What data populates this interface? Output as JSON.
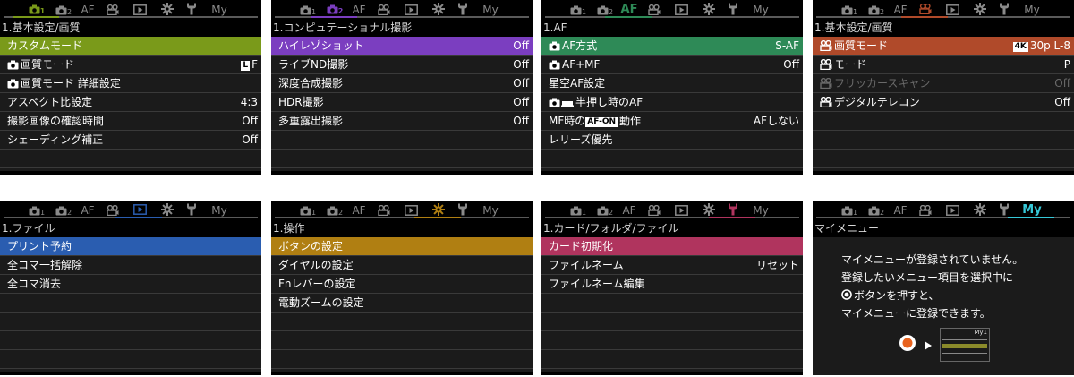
{
  "tab_icons": [
    "camera1-icon",
    "camera2-icon",
    "af-tab",
    "video-icon",
    "playback-icon",
    "gear-icon",
    "wrench-icon",
    "my-tab"
  ],
  "colors": {
    "shooting1": "#7a9a1a",
    "shooting2": "#7b3ec0",
    "af": "#2e8a57",
    "video": "#b04a2a",
    "playback": "#2a5db0",
    "custom": "#b07f12",
    "setup": "#b0345e",
    "my": "#36c9d9"
  },
  "tab_labels": {
    "af": "AF",
    "my": "My",
    "sub1": "1",
    "sub2": "2"
  },
  "panels": [
    {
      "id": "shooting1",
      "active": 0,
      "header": "1.基本設定/画質",
      "rows": [
        {
          "label": "カスタムモード",
          "value": ""
        },
        {
          "label": "画質モード",
          "value": "F",
          "icon": "camera",
          "value_badge": "L"
        },
        {
          "label": "画質モード 詳細設定",
          "value": "",
          "icon": "camera"
        },
        {
          "label": "アスペクト比設定",
          "value": "4:3"
        },
        {
          "label": "撮影画像の確認時間",
          "value": "Off"
        },
        {
          "label": "シェーディング補正",
          "value": "Off"
        },
        {
          "label": "",
          "value": ""
        }
      ]
    },
    {
      "id": "shooting2",
      "active": 1,
      "header": "1.コンピュテーショナル撮影",
      "rows": [
        {
          "label": "ハイレゾショット",
          "value": "Off"
        },
        {
          "label": "ライブND撮影",
          "value": "Off"
        },
        {
          "label": "深度合成撮影",
          "value": "Off"
        },
        {
          "label": "HDR撮影",
          "value": "Off"
        },
        {
          "label": "多重露出撮影",
          "value": "Off"
        },
        {
          "label": "",
          "value": ""
        },
        {
          "label": "",
          "value": ""
        }
      ]
    },
    {
      "id": "af",
      "active": 2,
      "header": "1.AF",
      "rows": [
        {
          "label": "AF方式",
          "value": "S-AF",
          "icon": "camera"
        },
        {
          "label": "AF+MF",
          "value": "Off",
          "icon": "camera"
        },
        {
          "label": "星空AF設定",
          "value": ""
        },
        {
          "label": "半押し時のAF",
          "value": "",
          "icon": "camera-video"
        },
        {
          "label": "動作",
          "label_prefix": "MF時の",
          "label_badge": "AF-ON",
          "value": "AFしない"
        },
        {
          "label": "レリーズ優先",
          "value": ""
        },
        {
          "label": "",
          "value": ""
        }
      ]
    },
    {
      "id": "video",
      "active": 3,
      "header": "1.基本設定/画質",
      "rows": [
        {
          "label": "画質モード",
          "value": "30p L-8",
          "icon": "video",
          "value_badge": "4K"
        },
        {
          "label": "モード",
          "value": "P",
          "icon": "video"
        },
        {
          "label": "フリッカースキャン",
          "value": "Off",
          "icon": "video",
          "dim": true
        },
        {
          "label": "デジタルテレコン",
          "value": "Off",
          "icon": "video"
        },
        {
          "label": "",
          "value": ""
        },
        {
          "label": "",
          "value": ""
        },
        {
          "label": "",
          "value": ""
        }
      ]
    },
    {
      "id": "playback",
      "active": 4,
      "header": "1.ファイル",
      "rows": [
        {
          "label": "プリント予約",
          "value": ""
        },
        {
          "label": "全コマ一括解除",
          "value": ""
        },
        {
          "label": "全コマ消去",
          "value": ""
        },
        {
          "label": "",
          "value": ""
        },
        {
          "label": "",
          "value": ""
        },
        {
          "label": "",
          "value": ""
        },
        {
          "label": "",
          "value": ""
        }
      ]
    },
    {
      "id": "custom",
      "active": 5,
      "header": "1.操作",
      "rows": [
        {
          "label": "ボタンの設定",
          "value": ""
        },
        {
          "label": "ダイヤルの設定",
          "value": ""
        },
        {
          "label": "Fnレバーの設定",
          "value": ""
        },
        {
          "label": "電動ズームの設定",
          "value": ""
        },
        {
          "label": "",
          "value": ""
        },
        {
          "label": "",
          "value": ""
        },
        {
          "label": "",
          "value": ""
        }
      ]
    },
    {
      "id": "setup",
      "active": 6,
      "header": "1.カード/フォルダ/ファイル",
      "rows": [
        {
          "label": "カード初期化",
          "value": ""
        },
        {
          "label": "ファイルネーム",
          "value": "リセット"
        },
        {
          "label": "ファイルネーム編集",
          "value": ""
        },
        {
          "label": "",
          "value": ""
        },
        {
          "label": "",
          "value": ""
        },
        {
          "label": "",
          "value": ""
        },
        {
          "label": "",
          "value": ""
        }
      ]
    },
    {
      "id": "my",
      "active": 7,
      "header": "マイメニュー",
      "message": [
        "マイメニューが登録されていません。",
        "登録したいメニュー項目を選択中に",
        "ボタンを押すと、",
        "マイメニューに登録できます。"
      ],
      "mini_label": "My1"
    }
  ]
}
